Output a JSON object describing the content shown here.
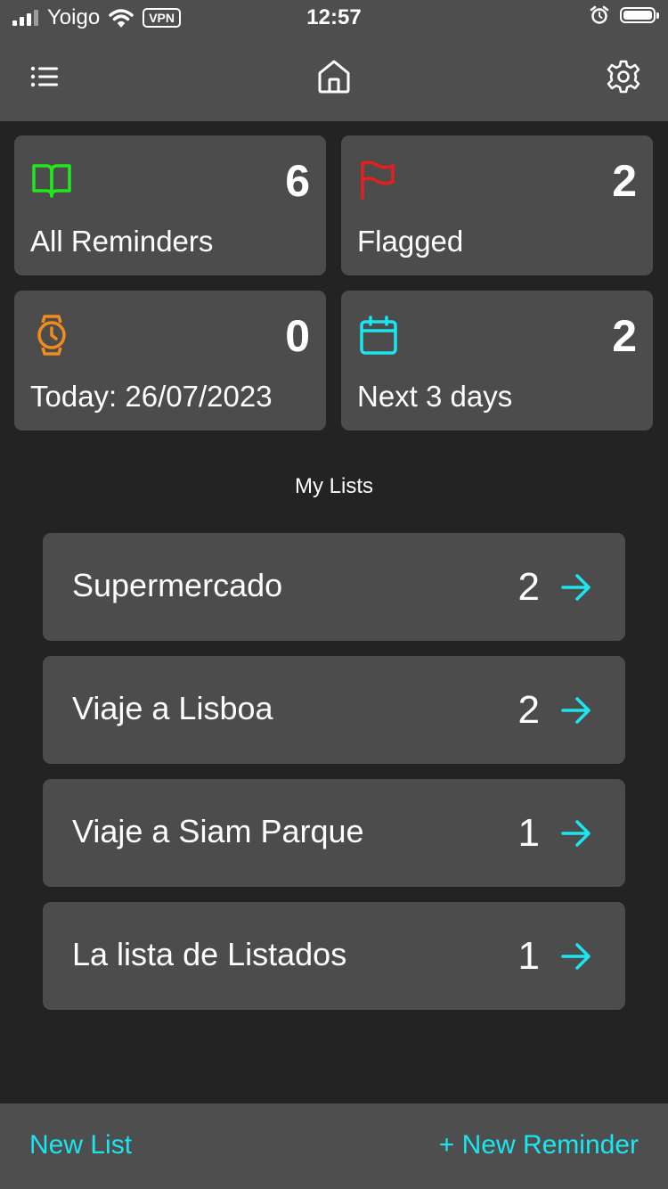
{
  "status_bar": {
    "carrier": "Yoigo",
    "vpn": "VPN",
    "time": "12:57"
  },
  "nav": {
    "menu_icon": "list-icon",
    "home_icon": "home-icon",
    "settings_icon": "gear-icon"
  },
  "tiles": [
    {
      "label": "All Reminders",
      "count": "6",
      "icon": "book-icon",
      "color": "#22e61e"
    },
    {
      "label": "Flagged",
      "count": "2",
      "icon": "flag-icon",
      "color": "#e61e1e"
    },
    {
      "label": "Today: 26/07/2023",
      "count": "0",
      "icon": "watch-icon",
      "color": "#f08c1e"
    },
    {
      "label": "Next 3 days",
      "count": "2",
      "icon": "calendar-icon",
      "color": "#19e6f0"
    }
  ],
  "lists_title": "My Lists",
  "lists": [
    {
      "name": "Supermercado",
      "count": "2"
    },
    {
      "name": "Viaje a Lisboa",
      "count": "2"
    },
    {
      "name": "Viaje a Siam Parque",
      "count": "1"
    },
    {
      "name": "La lista de Listados",
      "count": "1"
    }
  ],
  "bottom_bar": {
    "new_list": "New List",
    "new_reminder": "+ New Reminder"
  },
  "accent_color": "#19e6f0"
}
